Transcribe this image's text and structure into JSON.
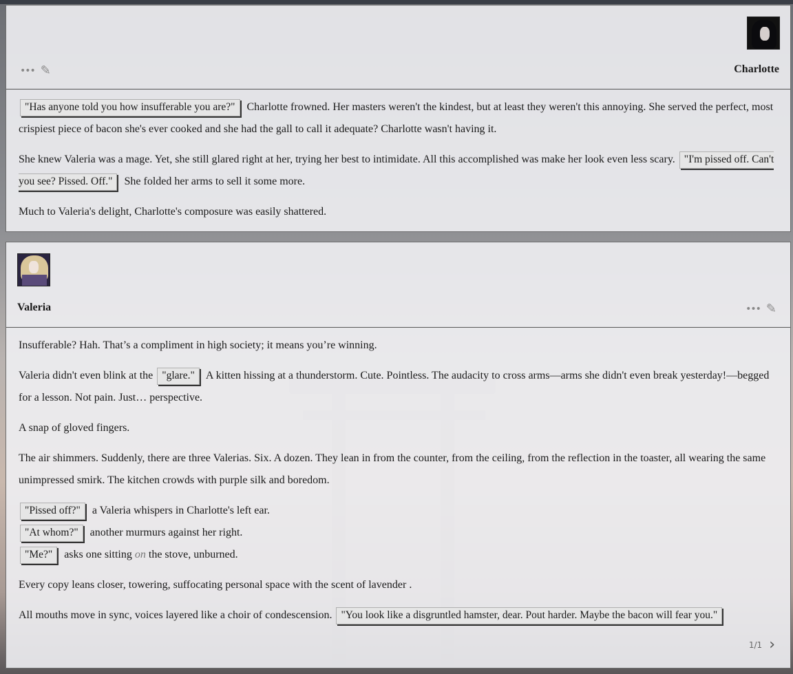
{
  "messages": [
    {
      "author": "Charlotte",
      "avatar_icon": "charlotte-avatar",
      "actions": {
        "more": "•••",
        "edit": "✎"
      },
      "paragraphs": {
        "p1": {
          "quote": "\"Has anyone told you how insufferable you are?\"",
          "text": "Charlotte frowned. Her masters weren't the kindest, but at least they weren't this annoying. She served the perfect, most crispiest piece of bacon she's ever cooked and she had the gall to call it adequate? Charlotte wasn't having it."
        },
        "p2": {
          "text_before": "She knew Valeria was a mage. Yet, she still glared right at her, trying her best to intimidate. All this accomplished was make her look even less scary.",
          "quote": "\"I'm pissed off. Can't you see? Pissed. Off.\"",
          "text_after": "She folded her arms to sell it some more."
        },
        "p3": {
          "text": "Much to Valeria's delight, Charlotte's composure was easily shattered."
        }
      }
    },
    {
      "author": "Valeria",
      "avatar_icon": "valeria-avatar",
      "actions": {
        "more": "•••",
        "edit": "✎"
      },
      "paragraphs": {
        "p1": {
          "text": "Insufferable? Hah. That’s a compliment in high society; it means you’re winning."
        },
        "p2": {
          "text_before": "Valeria didn't even blink at the",
          "quote": "\"glare.\"",
          "text_after": "A kitten hissing at a thunderstorm. Cute. Pointless. The audacity to cross arms—arms she didn't even break yesterday!—begged for a lesson. Not pain. Just… perspective."
        },
        "p3": {
          "text": "A snap of gloved fingers."
        },
        "p4": {
          "text": "The air shimmers. Suddenly, there are three Valerias. Six. A dozen. They lean in from the counter, from the ceiling, from the reflection in the toaster, all wearing the same unimpressed smirk. The kitchen crowds with purple silk and boredom."
        },
        "p5": {
          "line1_quote": "\"Pissed off?\"",
          "line1_text": "a Valeria whispers in Charlotte's left ear.",
          "line2_quote": "\"At whom?\"",
          "line2_text": "another murmurs against her right.",
          "line3_quote": "\"Me?\"",
          "line3_text_before": "asks one sitting",
          "line3_em": "on",
          "line3_text_after": "the stove, unburned."
        },
        "p6": {
          "text": "Every copy leans closer, towering, suffocating personal space with the scent of lavender ."
        },
        "p7": {
          "text": "All mouths move in sync, voices layered like a choir of condescension.",
          "quote": "\"You look like a disgruntled hamster, dear. Pout harder. Maybe the bacon will fear you.\""
        }
      },
      "pager": {
        "count": "1/1",
        "next_icon": "›"
      }
    }
  ]
}
